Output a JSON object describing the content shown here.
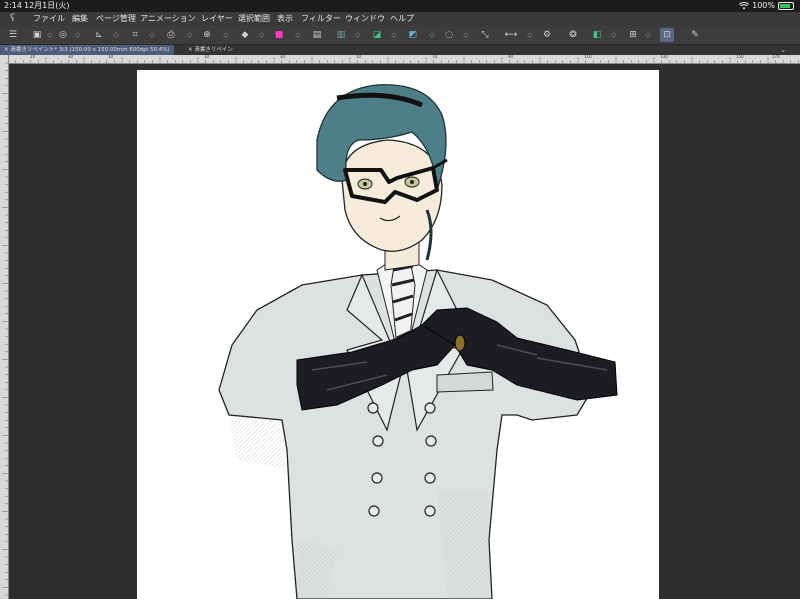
{
  "status": {
    "time": "2:14",
    "date": "12月1日(火)",
    "battery": "100%"
  },
  "menu": {
    "items": [
      "ファイル",
      "編集",
      "ページ管理",
      "アニメーション",
      "レイヤー",
      "選択範囲",
      "表示",
      "フィルター",
      "ウィンドウ",
      "ヘルプ"
    ]
  },
  "tabs": [
    {
      "label": "清書きリペイント* 3/3 (150.00 x 150.00mm 600dpi 50.4%)"
    },
    {
      "label": "清書きリペイン"
    }
  ],
  "ruler": {
    "top_labels": [
      "20",
      "30",
      "10",
      "10",
      "30",
      "50",
      "70",
      "90",
      "110",
      "130",
      "150",
      "170"
    ],
    "left_labels": [
      "20",
      "40",
      "60",
      "80",
      "100",
      "120",
      "140",
      "160"
    ]
  },
  "icons": {
    "app": "clip-studio-logo-icon",
    "wifi": "wifi-icon",
    "battery": "battery-icon"
  },
  "colors": {
    "menubar": "#3a3a3a",
    "toolbar": "#3d3d3d",
    "active_tab": "#4d5e7d",
    "canvas_bg": "#2e2e2e",
    "hair": "#4f7f86",
    "coat": "#dde1e1",
    "glove": "#1c1d22"
  }
}
